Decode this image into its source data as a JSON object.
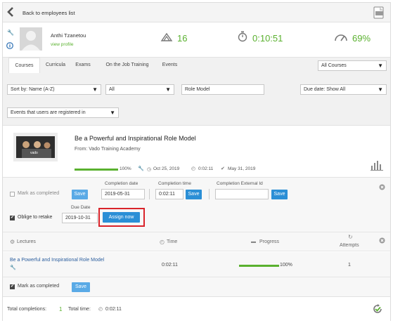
{
  "nav": {
    "back_label": "Back to employees list"
  },
  "user": {
    "name": "Anthi Tzanetou",
    "profile_link": "view profile",
    "stat_courses": "16",
    "stat_time": "0:10:51",
    "stat_progress": "69%"
  },
  "tabs": [
    "Courses",
    "Curricula",
    "Exams",
    "On the Job Training",
    "Events"
  ],
  "filters": {
    "all_courses": "All Courses",
    "sort_by": "Sort by: Name (A-Z)",
    "status": "All",
    "search": "Role Model",
    "due_date": "Due date: Show All",
    "events": "Events that users are registered in"
  },
  "course": {
    "title": "Be a Powerful and Inspirational Role Model",
    "from": "From: Vado Training Academy",
    "thumb_text": "vado",
    "progress_label": "100%",
    "progress": 1.0,
    "date1": "Oct 25, 2019",
    "time": "0:02:11",
    "date2": "May 31, 2019"
  },
  "completion": {
    "mark_label": "Mark as completed",
    "save_label": "Save",
    "date_label": "Completion date",
    "date_value": "2019-05-31",
    "time_label": "Completion time",
    "time_value": "0:02:11",
    "ext_label": "Completion External Id",
    "ext_value": "",
    "retake_label": "Oblige to retake",
    "due_label": "Due Date",
    "due_value": "2019-10-31",
    "assign_label": "Assign now"
  },
  "lectures": {
    "col_lectures": "Lectures",
    "col_time": "Time",
    "col_progress": "Progress",
    "col_attempts": "Attempts",
    "row": {
      "title": "Be a Powerful and Inspirational Role Model",
      "time": "0:02:11",
      "progress_label": "100%",
      "progress": 1.0,
      "attempts": "1"
    },
    "mark_label": "Mark as completed",
    "save_label": "Save"
  },
  "footer": {
    "total_completions_label": "Total completions:",
    "total_completions": "1",
    "total_time_label": "Total time:",
    "total_time": "0:02:11"
  },
  "colors": {
    "accent_green": "#5ab12f",
    "button_blue": "#2b8fd6",
    "highlight_red": "#d9232a"
  }
}
